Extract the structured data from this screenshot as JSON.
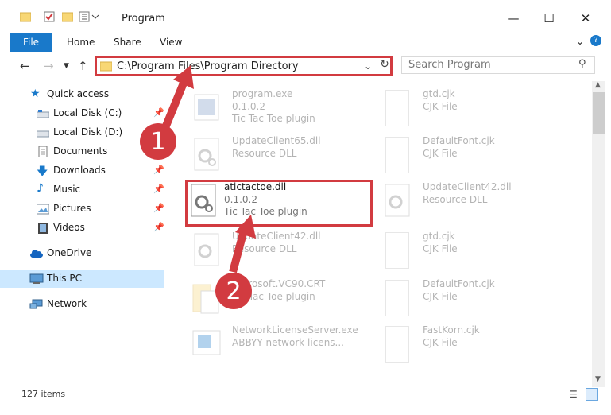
{
  "window": {
    "title": "Program",
    "minimize_icon": "minimize-icon",
    "maximize_icon": "maximize-icon",
    "close_icon": "close-icon"
  },
  "ribbon": {
    "tabs": [
      "File",
      "Home",
      "Share",
      "View"
    ]
  },
  "nav": {
    "address": "C:\\Program Files\\Program Directory",
    "search_placeholder": "Search Program"
  },
  "sidebar": {
    "items": [
      {
        "label": "Quick access",
        "icon": "star-icon",
        "pinned": false
      },
      {
        "label": "Local Disk (C:)",
        "icon": "drive-icon",
        "pinned": true
      },
      {
        "label": "Local Disk (D:)",
        "icon": "drive-icon",
        "pinned": false
      },
      {
        "label": "Documents",
        "icon": "document-icon",
        "pinned": false
      },
      {
        "label": "Downloads",
        "icon": "download-icon",
        "pinned": true
      },
      {
        "label": "Music",
        "icon": "music-icon",
        "pinned": true
      },
      {
        "label": "Pictures",
        "icon": "picture-icon",
        "pinned": true
      },
      {
        "label": "Videos",
        "icon": "video-icon",
        "pinned": true
      },
      {
        "label": "OneDrive",
        "icon": "cloud-icon",
        "pinned": false
      },
      {
        "label": "This PC",
        "icon": "computer-icon",
        "pinned": false,
        "selected": true
      },
      {
        "label": "Network",
        "icon": "network-icon",
        "pinned": false
      }
    ]
  },
  "files": [
    {
      "name": "program.exe",
      "line1": "0.1.0.2",
      "line2": "Tic Tac Toe plugin"
    },
    {
      "name": "gtd.cjk",
      "line1": "CJK File",
      "line2": ""
    },
    {
      "name": "UpdateClient65.dll",
      "line1": "Resource DLL",
      "line2": ""
    },
    {
      "name": "DefaultFont.cjk",
      "line1": "CJK File",
      "line2": ""
    },
    {
      "name": "atictactoe.dll",
      "line1": "0.1.0.2",
      "line2": "Tic Tac Toe plugin"
    },
    {
      "name": "UpdateClient42.dll",
      "line1": "Resource DLL",
      "line2": ""
    },
    {
      "name": "UpdateClient42.dll",
      "line1": "Resource DLL",
      "line2": ""
    },
    {
      "name": "gtd.cjk",
      "line1": "CJK File",
      "line2": ""
    },
    {
      "name": "Microsoft.VC90.CRT",
      "line1": "",
      "line2": "Tic Tac Toe plugin"
    },
    {
      "name": "DefaultFont.cjk",
      "line1": "CJK File",
      "line2": ""
    },
    {
      "name": "NetworkLicenseServer.exe",
      "line1": "ABBYY network licens...",
      "line2": ""
    },
    {
      "name": "FastKorn.cjk",
      "line1": "CJK File",
      "line2": ""
    }
  ],
  "status": {
    "item_count": "127 items"
  },
  "callouts": [
    "1",
    "2"
  ],
  "colors": {
    "accent": "#1979ca",
    "highlight": "#d23b40"
  }
}
